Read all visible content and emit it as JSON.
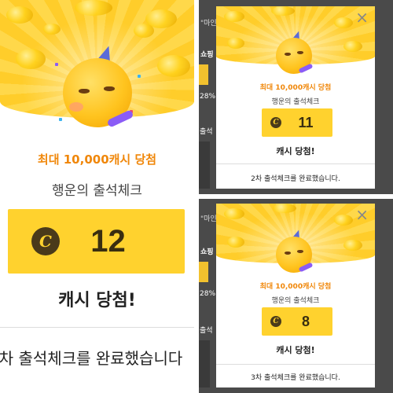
{
  "main": {
    "headline": "최대 10,000캐시 당첨",
    "subtitle": "행운의 출석체크",
    "coin_symbol": "C",
    "cash_amount": "12",
    "result": "캐시 당첨!",
    "footer": "차 출석체크를 완료했습니다"
  },
  "popup_top": {
    "headline": "최대 10,000캐시 당첨",
    "subtitle": "행운의 출석체크",
    "coin_symbol": "C",
    "cash_amount": "11",
    "result": "캐시 당첨!",
    "footer": "2차 출석체크를 완료했습니다.",
    "close": "×",
    "bg_text": [
      "\"마인",
      "쇼핑",
      "28%",
      "출석"
    ]
  },
  "popup_bottom": {
    "headline": "최대 10,000캐시 당첨",
    "subtitle": "행운의 출석체크",
    "coin_symbol": "C",
    "cash_amount": "8",
    "result": "캐시 당첨!",
    "footer": "3차 출석체크를 완료했습니다.",
    "close": "×",
    "bg_text": [
      "\"마인",
      "쇼핑",
      "28%",
      "출석"
    ]
  },
  "colors": {
    "accent_orange": "#f0870a",
    "cash_box": "#ffd22e",
    "coin_dark": "#4a3a1a"
  },
  "icons": [
    "party-face-emoji-icon",
    "coin-c-icon",
    "close-icon"
  ]
}
